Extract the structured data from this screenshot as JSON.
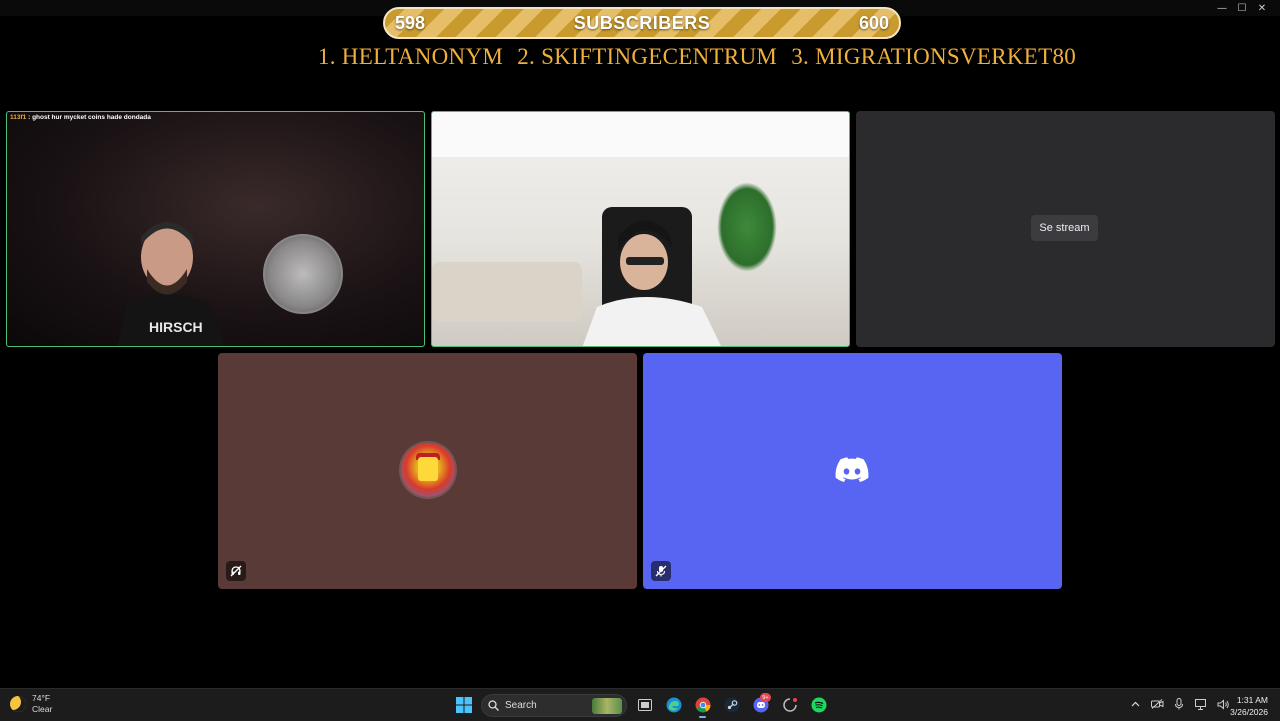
{
  "subscribers": {
    "current": "598",
    "label": "SUBSCRIBERS",
    "goal": "600",
    "progress": 0.997
  },
  "leaderboard": [
    "1. HELTANONYM",
    "2. SKIFTINGECENTRUM",
    "3. MIGRATIONSVERKET80"
  ],
  "chat": {
    "user": "113f1",
    "separator": " : ",
    "message": "ghost hur mycket coins hade dondada"
  },
  "tiles": {
    "stream_button": "Se stream"
  },
  "taskbar": {
    "weather_temp": "74°F",
    "weather_desc": "Clear",
    "search_placeholder": "Search",
    "discord_badge": "9+",
    "time": "1:31 AM",
    "date": "3/26/2026"
  },
  "colors": {
    "cam_border": "#4bbf7a",
    "leaderboard": "#f0b03c",
    "discord": "#5865f2",
    "muted_tile": "#5a3a37"
  }
}
